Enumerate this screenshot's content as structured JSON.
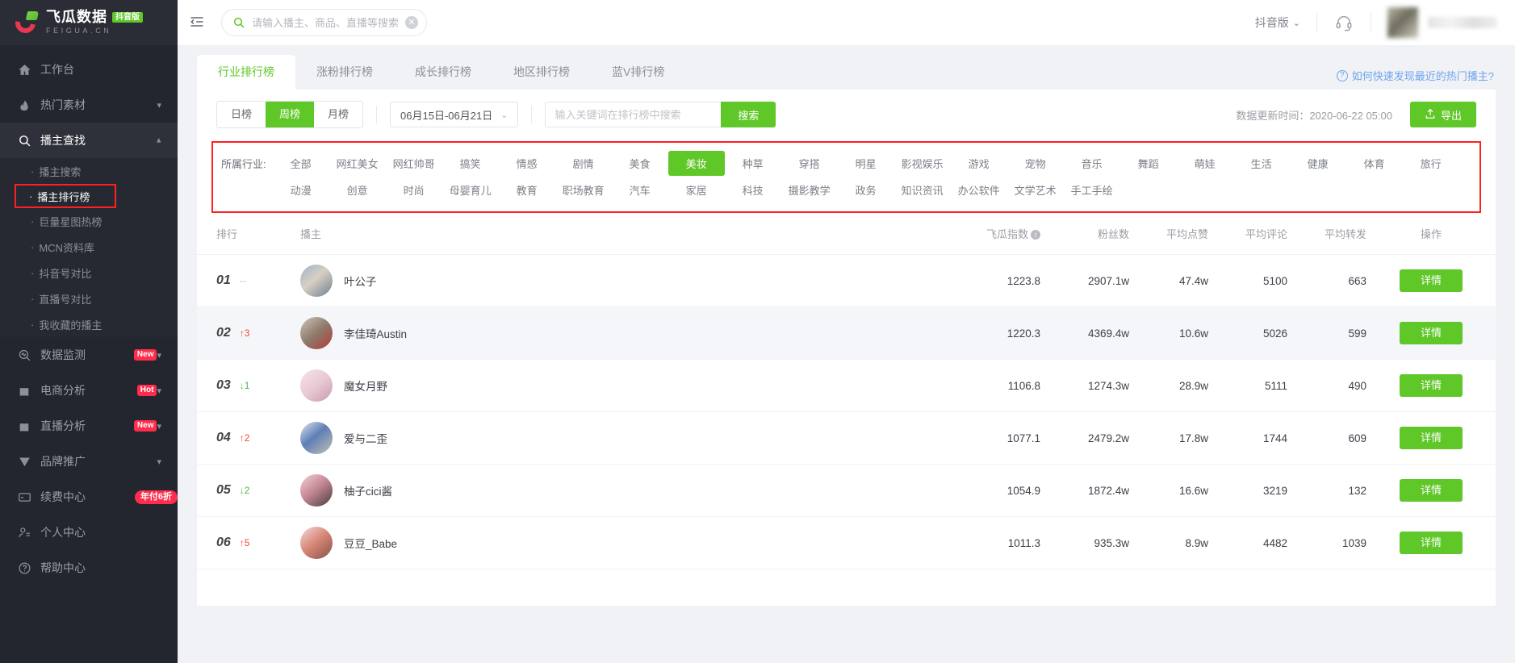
{
  "brand": {
    "name_cn": "飞瓜数据",
    "name_en": "FEIGUA.CN",
    "badge": "抖音版"
  },
  "sidebar": {
    "items": [
      {
        "label": "工作台",
        "icon": "home-icon",
        "has_chevron": false,
        "tag": null
      },
      {
        "label": "热门素材",
        "icon": "fire-icon",
        "has_chevron": true,
        "tag": null
      },
      {
        "label": "播主查找",
        "icon": "search-icon",
        "has_chevron": true,
        "tag": null,
        "expanded": true
      },
      {
        "label": "数据监测",
        "icon": "monitor-icon",
        "has_chevron": true,
        "tag": "New"
      },
      {
        "label": "电商分析",
        "icon": "bag-icon",
        "has_chevron": true,
        "tag": "Hot"
      },
      {
        "label": "直播分析",
        "icon": "bag-icon",
        "has_chevron": true,
        "tag": "New"
      },
      {
        "label": "品牌推广",
        "icon": "shield-icon",
        "has_chevron": true,
        "tag": null
      },
      {
        "label": "续费中心",
        "icon": "card-icon",
        "has_chevron": false,
        "tag": "年付6折"
      },
      {
        "label": "个人中心",
        "icon": "user-icon",
        "has_chevron": false,
        "tag": null
      },
      {
        "label": "帮助中心",
        "icon": "question-icon",
        "has_chevron": false,
        "tag": null
      }
    ],
    "submenu": [
      {
        "label": "播主搜索",
        "current": false
      },
      {
        "label": "播主排行榜",
        "current": true
      },
      {
        "label": "巨量星图热榜",
        "current": false
      },
      {
        "label": "MCN资料库",
        "current": false
      },
      {
        "label": "抖音号对比",
        "current": false
      },
      {
        "label": "直播号对比",
        "current": false
      },
      {
        "label": "我收藏的播主",
        "current": false
      }
    ]
  },
  "topbar": {
    "search_placeholder": "请输入播主、商品、直播等搜索",
    "search_value": "",
    "version_label": "抖音版"
  },
  "tabs": [
    {
      "label": "行业排行榜",
      "active": true
    },
    {
      "label": "涨粉排行榜",
      "active": false
    },
    {
      "label": "成长排行榜",
      "active": false
    },
    {
      "label": "地区排行榜",
      "active": false
    },
    {
      "label": "蓝V排行榜",
      "active": false
    }
  ],
  "help_link": "如何快速发现最近的热门播主?",
  "filters": {
    "period": [
      {
        "label": "日榜",
        "on": false
      },
      {
        "label": "周榜",
        "on": true
      },
      {
        "label": "月榜",
        "on": false
      }
    ],
    "date_range": "06月15日-06月21日",
    "keyword_placeholder": "输入关键词在排行榜中搜索",
    "keyword_value": "",
    "search_button": "搜索",
    "update_time_label": "数据更新时间：2020-06-22 05:00",
    "export_button": "导出"
  },
  "industry": {
    "label": "所属行业:",
    "tags": [
      {
        "label": "全部",
        "on": false
      },
      {
        "label": "网红美女",
        "on": false
      },
      {
        "label": "网红帅哥",
        "on": false
      },
      {
        "label": "搞笑",
        "on": false
      },
      {
        "label": "情感",
        "on": false
      },
      {
        "label": "剧情",
        "on": false
      },
      {
        "label": "美食",
        "on": false
      },
      {
        "label": "美妆",
        "on": true
      },
      {
        "label": "种草",
        "on": false
      },
      {
        "label": "穿搭",
        "on": false
      },
      {
        "label": "明星",
        "on": false
      },
      {
        "label": "影视娱乐",
        "on": false
      },
      {
        "label": "游戏",
        "on": false
      },
      {
        "label": "宠物",
        "on": false
      },
      {
        "label": "音乐",
        "on": false
      },
      {
        "label": "舞蹈",
        "on": false
      },
      {
        "label": "萌娃",
        "on": false
      },
      {
        "label": "生活",
        "on": false
      },
      {
        "label": "健康",
        "on": false
      },
      {
        "label": "体育",
        "on": false
      },
      {
        "label": "旅行",
        "on": false
      },
      {
        "label": "动漫",
        "on": false
      },
      {
        "label": "创意",
        "on": false
      },
      {
        "label": "时尚",
        "on": false
      },
      {
        "label": "母婴育儿",
        "on": false
      },
      {
        "label": "教育",
        "on": false
      },
      {
        "label": "职场教育",
        "on": false
      },
      {
        "label": "汽车",
        "on": false
      },
      {
        "label": "家居",
        "on": false
      },
      {
        "label": "科技",
        "on": false
      },
      {
        "label": "摄影教学",
        "on": false
      },
      {
        "label": "政务",
        "on": false
      },
      {
        "label": "知识资讯",
        "on": false
      },
      {
        "label": "办公软件",
        "on": false
      },
      {
        "label": "文学艺术",
        "on": false
      },
      {
        "label": "手工手绘",
        "on": false
      }
    ]
  },
  "table": {
    "columns": [
      "排行",
      "播主",
      "飞瓜指数",
      "粉丝数",
      "平均点赞",
      "平均评论",
      "平均转发",
      "操作"
    ],
    "detail_button": "详情",
    "rows": [
      {
        "rank": "01",
        "delta": "--",
        "dir": "flat",
        "name": "叶公子",
        "index": "1223.8",
        "fans": "2907.1w",
        "likes": "47.4w",
        "comments": "5100",
        "shares": "663"
      },
      {
        "rank": "02",
        "delta": "3",
        "dir": "up",
        "name": "李佳琦Austin",
        "index": "1220.3",
        "fans": "4369.4w",
        "likes": "10.6w",
        "comments": "5026",
        "shares": "599"
      },
      {
        "rank": "03",
        "delta": "1",
        "dir": "down",
        "name": "魔女月野",
        "index": "1106.8",
        "fans": "1274.3w",
        "likes": "28.9w",
        "comments": "5111",
        "shares": "490"
      },
      {
        "rank": "04",
        "delta": "2",
        "dir": "up",
        "name": "爱与二歪",
        "index": "1077.1",
        "fans": "2479.2w",
        "likes": "17.8w",
        "comments": "1744",
        "shares": "609"
      },
      {
        "rank": "05",
        "delta": "2",
        "dir": "down",
        "name": "柚子cici酱",
        "index": "1054.9",
        "fans": "1872.4w",
        "likes": "16.6w",
        "comments": "3219",
        "shares": "132"
      },
      {
        "rank": "06",
        "delta": "5",
        "dir": "up",
        "name": "豆豆_Babe",
        "index": "1011.3",
        "fans": "935.3w",
        "likes": "8.9w",
        "comments": "4482",
        "shares": "1039"
      }
    ]
  },
  "colors": {
    "accent_green": "#5fc727",
    "highlight_red": "#ff2020",
    "sidebar_bg": "#23262e",
    "link_blue": "#6fa4f0"
  }
}
